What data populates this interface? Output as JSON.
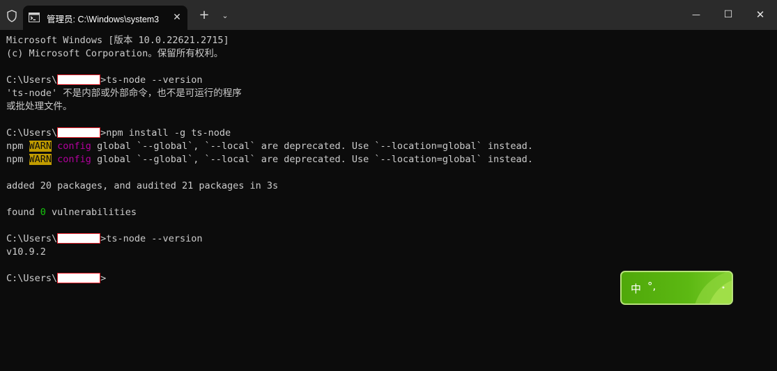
{
  "titlebar": {
    "tab_title": "管理员: C:\\Windows\\system3",
    "tab_close": "✕",
    "new_tab": "+",
    "dropdown": "⌄",
    "minimize": "—",
    "maximize": "☐",
    "close": "✕"
  },
  "terminal": {
    "l1": "Microsoft Windows [版本 10.0.22621.2715]",
    "l2": "(c) Microsoft Corporation。保留所有权利。",
    "prompt": "C:\\Users\\",
    "cmd1": ">ts-node --version",
    "err1": "'ts-node' 不是内部或外部命令，也不是可运行的程序",
    "err2": "或批处理文件。",
    "cmd2": ">npm install -g ts-node",
    "npm": "npm ",
    "warn": "WARN",
    "config": "config",
    "warn_msg": " global `--global`, `--local` are deprecated. Use `--location=global` instead.",
    "added": "added 20 packages, and audited 21 packages in 3s",
    "found": "found ",
    "zero": "0",
    "vulns": " vulnerabilities",
    "cmd3": ">ts-node --version",
    "version": "v10.9.2",
    "final_suffix": ">"
  },
  "ime": {
    "mode": "中",
    "punct": "°,"
  },
  "colors": {
    "background": "#0c0c0c",
    "titlebar": "#2b2b2b",
    "warn_bg": "#c19c00",
    "config_fg": "#b4009e",
    "zero_fg": "#16c60c"
  }
}
